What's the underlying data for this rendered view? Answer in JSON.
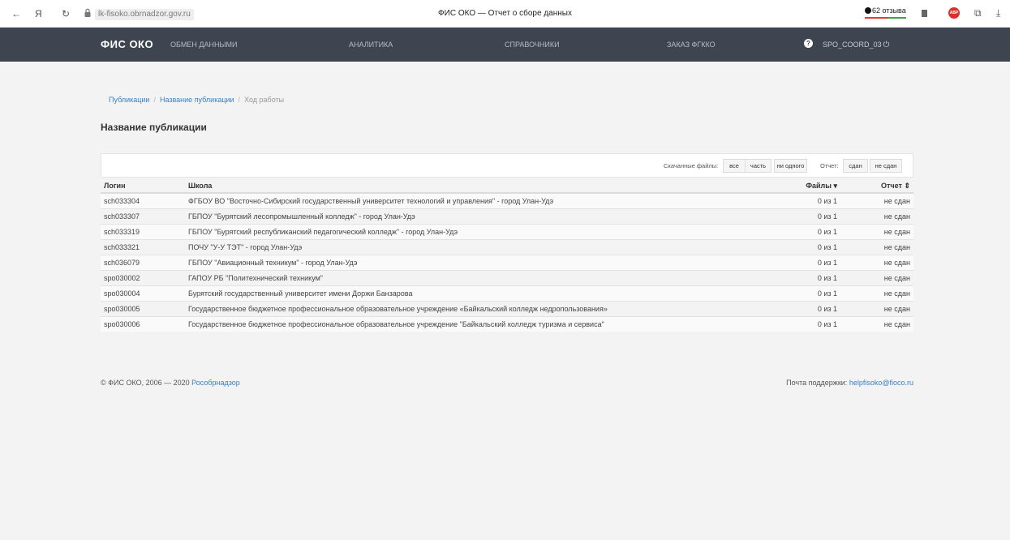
{
  "browser": {
    "back": "←",
    "logo": "Я",
    "reload": "↻",
    "url": "lk-fisoko.obrnadzor.gov.ru",
    "tab_title": "ФИС ОКО — Отчет о сборе данных",
    "reviews": "62 отзыва",
    "adblock_label": "ABP"
  },
  "nav": {
    "brand": "ФИС ОКО",
    "items": [
      {
        "label": "ОБМЕН ДАННЫМИ"
      },
      {
        "label": "АНАЛИТИКА"
      },
      {
        "label": "СПРАВОЧНИКИ"
      },
      {
        "label": "ЗАКАЗ ФГККО"
      }
    ],
    "help": "?",
    "user": "SPO_COORD_03"
  },
  "breadcrumb": {
    "items": [
      "Публикации",
      "Название публикации"
    ],
    "current": "Ход работы",
    "separator": "/"
  },
  "page_title": "Название публикации",
  "filters": {
    "files_label": "Скачанные файлы:",
    "files_options": [
      "все",
      "часть",
      "ни одного"
    ],
    "report_label": "Отчет:",
    "report_options": [
      "сдан",
      "не сдан"
    ]
  },
  "table": {
    "headers": {
      "login": "Логин",
      "school": "Школа",
      "files": "Файлы",
      "files_sort": "▾",
      "report": "Отчет",
      "report_sort": "⇕"
    },
    "rows": [
      {
        "login": "sch033304",
        "school": "ФГБОУ ВО \"Восточно-Сибирский государственный университет технологий и управления\" - город Улан-Удэ",
        "files": "0 из 1",
        "report": "не сдан"
      },
      {
        "login": "sch033307",
        "school": "ГБПОУ \"Бурятский лесопромышленный колледж\" - город Улан-Удэ",
        "files": "0 из 1",
        "report": "не сдан"
      },
      {
        "login": "sch033319",
        "school": "ГБПОУ \"Бурятский республиканский педагогический колледж\" - город Улан-Удэ",
        "files": "0 из 1",
        "report": "не сдан"
      },
      {
        "login": "sch033321",
        "school": "ПОЧУ \"У-У ТЭТ\" - город Улан-Удэ",
        "files": "0 из 1",
        "report": "не сдан"
      },
      {
        "login": "sch036079",
        "school": "ГБПОУ \"Авиационный техникум\" - город Улан-Удэ",
        "files": "0 из 1",
        "report": "не сдан"
      },
      {
        "login": "spo030002",
        "school": "ГАПОУ РБ \"Политехнический техникум\"",
        "files": "0 из 1",
        "report": "не сдан"
      },
      {
        "login": "spo030004",
        "school": "Бурятский государственный университет имени Доржи Банзарова",
        "files": "0 из 1",
        "report": "не сдан"
      },
      {
        "login": "spo030005",
        "school": "Государственное бюджетное профессиональное образовательное учреждение «Байкальский колледж недропользования»",
        "files": "0 из 1",
        "report": "не сдан"
      },
      {
        "login": "spo030006",
        "school": "Государственное бюджетное профессиональное образовательное учреждение \"Байкальский колледж туризма и сервиса\"",
        "files": "0 из 1",
        "report": "не сдан"
      }
    ]
  },
  "footer": {
    "copyright": "© ФИС ОКО, 2006 — 2020",
    "org_link": "Рособрнадзор",
    "support_label": "Почта поддержки:",
    "support_email": "helpfisoko@fioco.ru"
  }
}
